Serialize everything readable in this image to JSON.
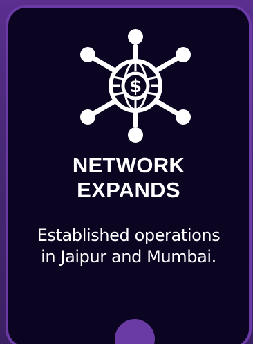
{
  "card": {
    "title": "NETWORK\nEXPANDS",
    "description": "Established operations\nin Jaipur and Mumbai.",
    "icon": "network-globe-dollar-icon"
  },
  "colors": {
    "card_background": "#0b0522",
    "border": "#6a3aa5",
    "page_background": "#4a2a78",
    "text": "#ffffff"
  }
}
